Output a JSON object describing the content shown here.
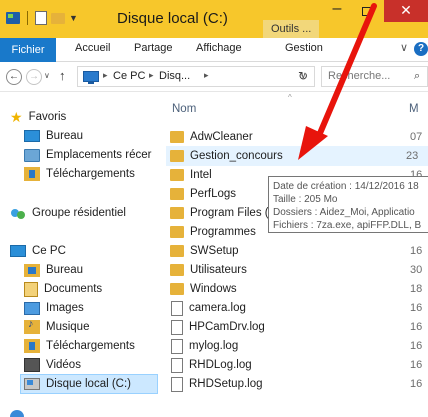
{
  "title_bar": {
    "title": "Disque local (C:)",
    "contextual_tab": "Outils ...",
    "minimize": "–",
    "close": "✕"
  },
  "ribbon": {
    "tabs": [
      "Fichier",
      "Accueil",
      "Partage",
      "Affichage",
      "Gestion"
    ],
    "help": "?"
  },
  "address_bar": {
    "crumbs": [
      "Ce PC",
      "Disq..."
    ],
    "search_placeholder": "Recherche..."
  },
  "nav_pane": {
    "favorites": {
      "label": "Favoris",
      "items": [
        "Bureau",
        "Emplacements récer",
        "Téléchargements"
      ]
    },
    "homegroup": "Groupe résidentiel",
    "this_pc": {
      "label": "Ce PC",
      "items": [
        "Bureau",
        "Documents",
        "Images",
        "Musique",
        "Téléchargements",
        "Vidéos",
        "Disque local (C:)"
      ]
    },
    "selected": "Disque local (C:)"
  },
  "file_list": {
    "column_name": "Nom",
    "column_date_partial": "M",
    "rows": [
      {
        "name": "AdwCleaner",
        "type": "folder",
        "date": "07"
      },
      {
        "name": "Gestion_concours",
        "type": "folder",
        "date": "23",
        "hover": true
      },
      {
        "name": "Intel",
        "type": "folder",
        "date": "16"
      },
      {
        "name": "PerfLogs",
        "type": "folder",
        "date": ""
      },
      {
        "name": "Program Files (x",
        "type": "folder",
        "date": ""
      },
      {
        "name": "Programmes",
        "type": "folder",
        "date": ""
      },
      {
        "name": "SWSetup",
        "type": "folder",
        "date": "16"
      },
      {
        "name": "Utilisateurs",
        "type": "folder",
        "date": "30"
      },
      {
        "name": "Windows",
        "type": "folder",
        "date": "18"
      },
      {
        "name": "camera.log",
        "type": "file",
        "date": "16"
      },
      {
        "name": "HPCamDrv.log",
        "type": "file",
        "date": "16"
      },
      {
        "name": "mylog.log",
        "type": "file",
        "date": "16"
      },
      {
        "name": "RHDLog.log",
        "type": "file",
        "date": "16"
      },
      {
        "name": "RHDSetup.log",
        "type": "file",
        "date": "16"
      }
    ]
  },
  "tooltip": {
    "line1": "Date de création : 14/12/2016 18",
    "line2": "Taille : 205 Mo",
    "line3": "Dossiers : Aidez_Moi, Applicatio",
    "line4": "Fichiers : 7za.exe, apiFFP.DLL, B"
  },
  "colors": {
    "title_bar": "#f7c72b",
    "file_tab": "#1979ca",
    "close_button": "#c8302a",
    "selection": "#cce8ff",
    "annotation_arrow": "#e8140c"
  }
}
